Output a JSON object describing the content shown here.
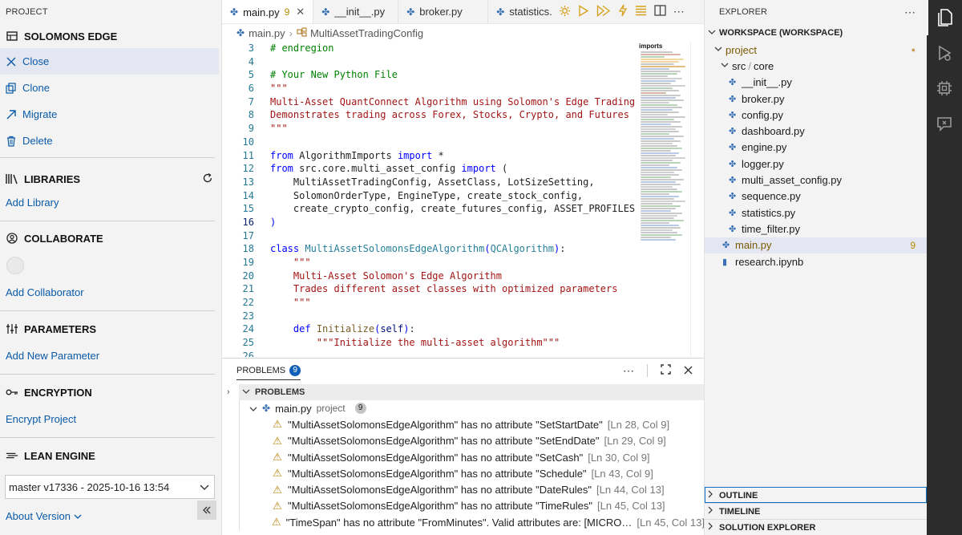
{
  "left": {
    "header": "PROJECT",
    "project_name": "SOLOMONS EDGE",
    "actions": [
      "Close",
      "Clone",
      "Migrate",
      "Delete"
    ],
    "libraries": {
      "title": "LIBRARIES",
      "add": "Add Library"
    },
    "collaborate": {
      "title": "COLLABORATE",
      "add": "Add Collaborator"
    },
    "parameters": {
      "title": "PARAMETERS",
      "add": "Add New Parameter"
    },
    "encryption": {
      "title": "ENCRYPTION",
      "action": "Encrypt Project"
    },
    "lean": {
      "title": "LEAN ENGINE",
      "selected_version": "master v17336 - 2025-10-16 13:54",
      "about": "About Version"
    }
  },
  "tabs": [
    {
      "label": "main.py",
      "count": "9",
      "active": true
    },
    {
      "label": "__init__.py"
    },
    {
      "label": "broker.py"
    },
    {
      "label": "statistics."
    }
  ],
  "breadcrumb": {
    "file": "main.py",
    "symbol": "MultiAssetTradingConfig"
  },
  "editor": {
    "line_numbers": [
      "3",
      "4",
      "5",
      "6",
      "7",
      "8",
      "9",
      "10",
      "11",
      "12",
      "13",
      "14",
      "15",
      "16",
      "17",
      "18",
      "19",
      "20",
      "21",
      "22",
      "23",
      "24",
      "25",
      "26"
    ],
    "current_line": "16",
    "minimap_title": "imports"
  },
  "code": {
    "l3": "# endregion",
    "l5": "# Your New Python File",
    "l6": "\"\"\"",
    "l7": "Multi-Asset QuantConnect Algorithm using Solomon's Edge Trading System",
    "l8": "Demonstrates trading across Forex, Stocks, Crypto, and Futures",
    "l9": "\"\"\"",
    "l11_kw1": "from",
    "l11_mod": " AlgorithmImports ",
    "l11_kw2": "import",
    "l11_rest": " *",
    "l12_kw1": "from",
    "l12_mod": " src.core.multi_asset_config ",
    "l12_kw2": "import",
    "l12_rest": " (",
    "l13": "    MultiAssetTradingConfig, AssetClass, LotSizeSetting,",
    "l14": "    SolomonOrderType, EngineType, create_stock_config,",
    "l15": "    create_crypto_config, create_futures_config, ASSET_PROFILES",
    "l16": ")",
    "l18_kw": "class",
    "l18_name": "MultiAssetSolomonsEdgeAlgorithm",
    "l18_base": "QCAlgorithm",
    "l19": "    \"\"\"",
    "l20": "    Multi-Asset Solomon's Edge Algorithm",
    "l21": "    Trades different asset classes with optimized parameters",
    "l22": "    \"\"\"",
    "l24_kw": "def",
    "l24_name": "Initialize",
    "l24_self": "self",
    "l25": "        \"\"\"Initialize the multi-asset algorithm\"\"\""
  },
  "problems": {
    "tab_label": "PROBLEMS",
    "count": "9",
    "section_label": "PROBLEMS",
    "file": {
      "name": "main.py",
      "project": "project",
      "count": "9"
    },
    "items": [
      {
        "msg": "\"MultiAssetSolomonsEdgeAlgorithm\" has no attribute \"SetStartDate\"",
        "loc": "[Ln 28, Col 9]"
      },
      {
        "msg": "\"MultiAssetSolomonsEdgeAlgorithm\" has no attribute \"SetEndDate\"",
        "loc": "[Ln 29, Col 9]"
      },
      {
        "msg": "\"MultiAssetSolomonsEdgeAlgorithm\" has no attribute \"SetCash\"",
        "loc": "[Ln 30, Col 9]"
      },
      {
        "msg": "\"MultiAssetSolomonsEdgeAlgorithm\" has no attribute \"Schedule\"",
        "loc": "[Ln 43, Col 9]"
      },
      {
        "msg": "\"MultiAssetSolomonsEdgeAlgorithm\" has no attribute \"DateRules\"",
        "loc": "[Ln 44, Col 13]"
      },
      {
        "msg": "\"MultiAssetSolomonsEdgeAlgorithm\" has no attribute \"TimeRules\"",
        "loc": "[Ln 45, Col 13]"
      },
      {
        "msg": "\"TimeSpan\" has no attribute \"FromMinutes\". Valid attributes are: [MICRO…",
        "loc": "[Ln 45, Col 13]"
      }
    ]
  },
  "explorer": {
    "header": "EXPLORER",
    "workspace": "WORKSPACE (WORKSPACE)",
    "project": "project",
    "folder": "src",
    "subfolder": "core",
    "files": [
      "__init__.py",
      "broker.py",
      "config.py",
      "dashboard.py",
      "engine.py",
      "logger.py",
      "multi_asset_config.py",
      "sequence.py",
      "statistics.py",
      "time_filter.py"
    ],
    "root_files": [
      {
        "name": "main.py",
        "count": "9"
      },
      {
        "name": "research.ipynb"
      }
    ],
    "bottom_sections": [
      "OUTLINE",
      "TIMELINE",
      "SOLUTION EXPLORER"
    ]
  },
  "colors": {
    "accent": "#0f5fb8",
    "warning": "#b8860b",
    "activity_bar": "#2c2c2c",
    "link": "#0a5aa8"
  }
}
